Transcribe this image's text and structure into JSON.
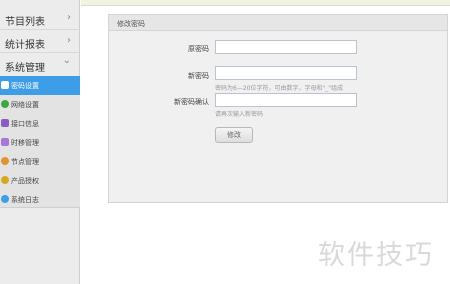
{
  "sidebar": {
    "groups": [
      {
        "label": "节目列表",
        "chevron": "›"
      },
      {
        "label": "统计报表",
        "chevron": "›"
      },
      {
        "label": "系统管理",
        "chevron": "⌄"
      }
    ],
    "items": [
      {
        "label": "密码设置",
        "icon": "user-key-icon",
        "color": "#ffffff",
        "active": true
      },
      {
        "label": "网络设置",
        "icon": "network-icon",
        "color": "#3aa845"
      },
      {
        "label": "接口信息",
        "icon": "interface-icon",
        "color": "#8a5cc4"
      },
      {
        "label": "时移管理",
        "icon": "calendar-icon",
        "color": "#a678d8"
      },
      {
        "label": "节点管理",
        "icon": "node-icon",
        "color": "#e0962a"
      },
      {
        "label": "产品授权",
        "icon": "key-icon",
        "color": "#d6a81e"
      },
      {
        "label": "系统日志",
        "icon": "log-icon",
        "color": "#3d9ee7"
      }
    ]
  },
  "panel": {
    "title": "修改密码",
    "fields": {
      "old_password": {
        "label": "原密码",
        "value": ""
      },
      "new_password": {
        "label": "新密码",
        "value": "",
        "hint": "密码为6—20位字符，可由数字，字母和\"_\"组成"
      },
      "confirm_password": {
        "label": "新密码确认",
        "value": "",
        "hint": "请再次输入新密码"
      }
    },
    "submit_label": "修改"
  },
  "watermark": "软件技巧",
  "colors": {
    "accent": "#3d9ee7",
    "sidebar_bg": "#ececec",
    "panel_bg": "#f0f0f0"
  }
}
